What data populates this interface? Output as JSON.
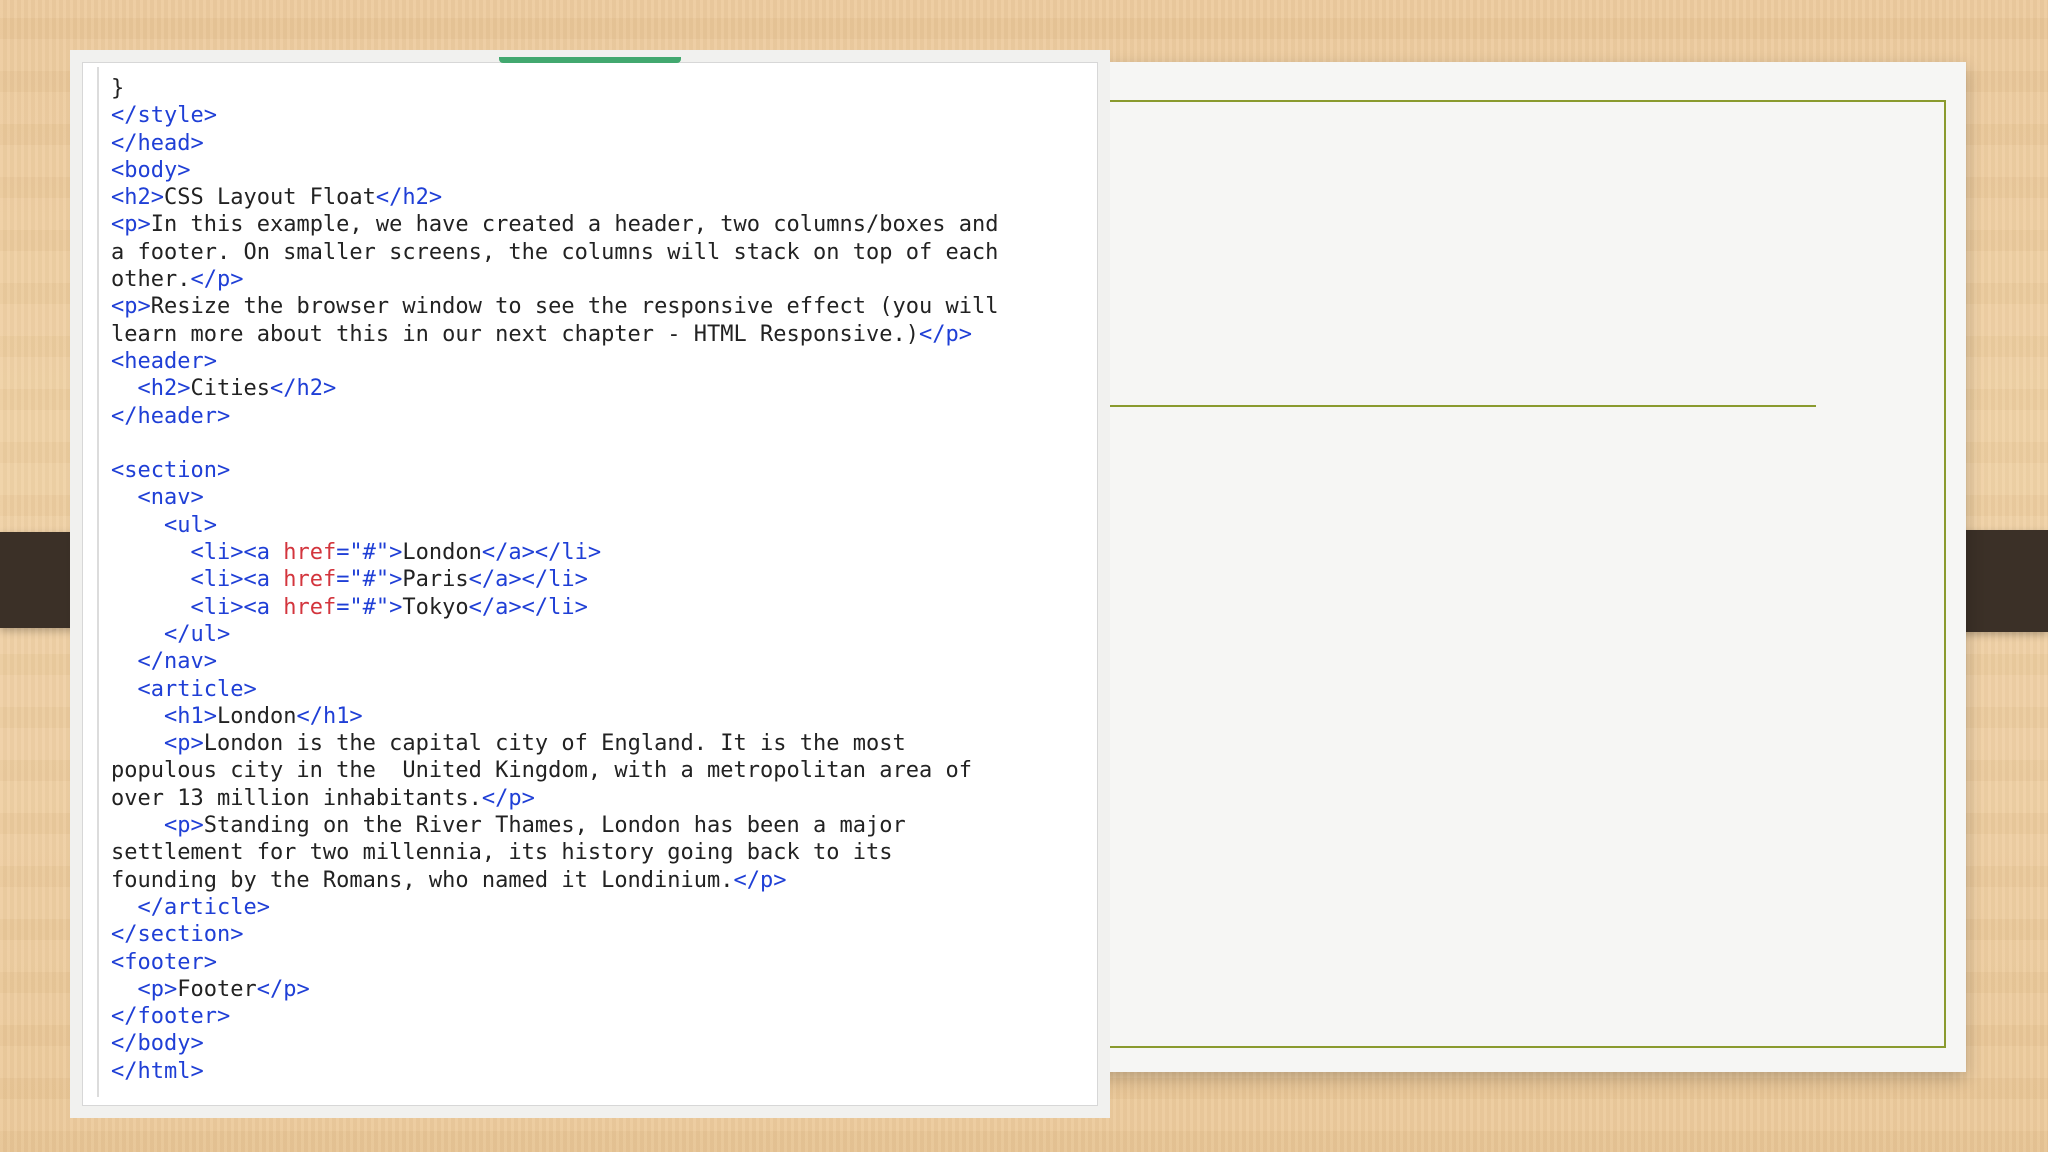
{
  "slide": {
    "background_color": "#efcfa2",
    "frame_color": "#8a9a2e",
    "code_colors": {
      "text": "#222222",
      "tag": "#1f3fd6",
      "attribute": "#d3353d",
      "value": "#1f3fd6"
    }
  },
  "code_screenshot": {
    "lines": [
      [
        {
          "t": "}",
          "c": "text"
        }
      ],
      [
        {
          "t": "</style>",
          "c": "tag"
        }
      ],
      [
        {
          "t": "</head>",
          "c": "tag"
        }
      ],
      [
        {
          "t": "<body>",
          "c": "tag"
        }
      ],
      [
        {
          "t": "<h2>",
          "c": "tag"
        },
        {
          "t": "CSS Layout Float",
          "c": "text"
        },
        {
          "t": "</h2>",
          "c": "tag"
        }
      ],
      [
        {
          "t": "<p>",
          "c": "tag"
        },
        {
          "t": "In this example, we have created a header, two columns/boxes and",
          "c": "text"
        }
      ],
      [
        {
          "t": "a footer. On smaller screens, the columns will stack on top of each",
          "c": "text"
        }
      ],
      [
        {
          "t": "other.",
          "c": "text"
        },
        {
          "t": "</p>",
          "c": "tag"
        }
      ],
      [
        {
          "t": "<p>",
          "c": "tag"
        },
        {
          "t": "Resize the browser window to see the responsive effect (you will",
          "c": "text"
        }
      ],
      [
        {
          "t": "learn more about this in our next chapter - HTML Responsive.)",
          "c": "text"
        },
        {
          "t": "</p>",
          "c": "tag"
        }
      ],
      [
        {
          "t": "<header>",
          "c": "tag"
        }
      ],
      [
        {
          "t": "  ",
          "c": "text"
        },
        {
          "t": "<h2>",
          "c": "tag"
        },
        {
          "t": "Cities",
          "c": "text"
        },
        {
          "t": "</h2>",
          "c": "tag"
        }
      ],
      [
        {
          "t": "</header>",
          "c": "tag"
        }
      ],
      [
        {
          "t": "",
          "c": "text"
        }
      ],
      [
        {
          "t": "<section>",
          "c": "tag"
        }
      ],
      [
        {
          "t": "  ",
          "c": "text"
        },
        {
          "t": "<nav>",
          "c": "tag"
        }
      ],
      [
        {
          "t": "    ",
          "c": "text"
        },
        {
          "t": "<ul>",
          "c": "tag"
        }
      ],
      [
        {
          "t": "      ",
          "c": "text"
        },
        {
          "t": "<li><a ",
          "c": "tag"
        },
        {
          "t": "href",
          "c": "attr"
        },
        {
          "t": "=\"#\"",
          "c": "val"
        },
        {
          "t": ">",
          "c": "tag"
        },
        {
          "t": "London",
          "c": "text"
        },
        {
          "t": "</a></li>",
          "c": "tag"
        }
      ],
      [
        {
          "t": "      ",
          "c": "text"
        },
        {
          "t": "<li><a ",
          "c": "tag"
        },
        {
          "t": "href",
          "c": "attr"
        },
        {
          "t": "=\"#\"",
          "c": "val"
        },
        {
          "t": ">",
          "c": "tag"
        },
        {
          "t": "Paris",
          "c": "text"
        },
        {
          "t": "</a></li>",
          "c": "tag"
        }
      ],
      [
        {
          "t": "      ",
          "c": "text"
        },
        {
          "t": "<li><a ",
          "c": "tag"
        },
        {
          "t": "href",
          "c": "attr"
        },
        {
          "t": "=\"#\"",
          "c": "val"
        },
        {
          "t": ">",
          "c": "tag"
        },
        {
          "t": "Tokyo",
          "c": "text"
        },
        {
          "t": "</a></li>",
          "c": "tag"
        }
      ],
      [
        {
          "t": "    ",
          "c": "text"
        },
        {
          "t": "</ul>",
          "c": "tag"
        }
      ],
      [
        {
          "t": "  ",
          "c": "text"
        },
        {
          "t": "</nav>",
          "c": "tag"
        }
      ],
      [
        {
          "t": "  ",
          "c": "text"
        },
        {
          "t": "<article>",
          "c": "tag"
        }
      ],
      [
        {
          "t": "    ",
          "c": "text"
        },
        {
          "t": "<h1>",
          "c": "tag"
        },
        {
          "t": "London",
          "c": "text"
        },
        {
          "t": "</h1>",
          "c": "tag"
        }
      ],
      [
        {
          "t": "    ",
          "c": "text"
        },
        {
          "t": "<p>",
          "c": "tag"
        },
        {
          "t": "London is the capital city of England. It is the most",
          "c": "text"
        }
      ],
      [
        {
          "t": "populous city in the  United Kingdom, with a metropolitan area of",
          "c": "text"
        }
      ],
      [
        {
          "t": "over 13 million inhabitants.",
          "c": "text"
        },
        {
          "t": "</p>",
          "c": "tag"
        }
      ],
      [
        {
          "t": "    ",
          "c": "text"
        },
        {
          "t": "<p>",
          "c": "tag"
        },
        {
          "t": "Standing on the River Thames, London has been a major",
          "c": "text"
        }
      ],
      [
        {
          "t": "settlement for two millennia, its history going back to its",
          "c": "text"
        }
      ],
      [
        {
          "t": "founding by the Romans, who named it Londinium.",
          "c": "text"
        },
        {
          "t": "</p>",
          "c": "tag"
        }
      ],
      [
        {
          "t": "  ",
          "c": "text"
        },
        {
          "t": "</article>",
          "c": "tag"
        }
      ],
      [
        {
          "t": "</section>",
          "c": "tag"
        }
      ],
      [
        {
          "t": "<footer>",
          "c": "tag"
        }
      ],
      [
        {
          "t": "  ",
          "c": "text"
        },
        {
          "t": "<p>",
          "c": "tag"
        },
        {
          "t": "Footer",
          "c": "text"
        },
        {
          "t": "</p>",
          "c": "tag"
        }
      ],
      [
        {
          "t": "</footer>",
          "c": "tag"
        }
      ],
      [
        {
          "t": "</body>",
          "c": "tag"
        }
      ],
      [
        {
          "t": "</html>",
          "c": "tag"
        }
      ]
    ]
  }
}
